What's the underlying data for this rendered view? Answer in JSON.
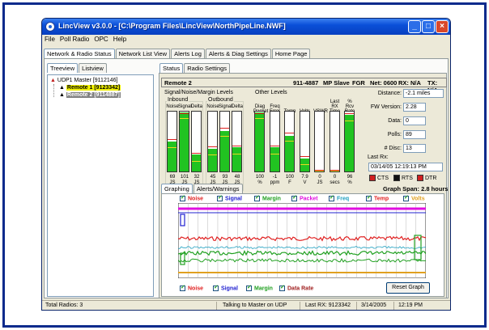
{
  "window": {
    "title": "LincView v3.0.0 - [C:\\Program Files\\LincView\\NorthPipeLine.NWF]"
  },
  "menu": [
    "File",
    "Poll Radio",
    "OPC",
    "Help"
  ],
  "main_tabs": [
    "Network & Radio Status",
    "Network List View",
    "Alerts Log",
    "Alerts & Diag Settings",
    "Home Page"
  ],
  "left_tabs": [
    "Treeview",
    "Listview"
  ],
  "right_tabs": [
    "Status",
    "Radio Settings"
  ],
  "tree": {
    "master": "UDP1 Master [9112146]",
    "remotes": [
      "Remote 1 [9123342]",
      "Remote 2 [9114887]"
    ]
  },
  "radio_header": {
    "name": "Remote 2",
    "id": "911-4887",
    "mode": "MP Slave",
    "fgr": "FGR",
    "net": "Net: 0600",
    "rx": "RX: N/A",
    "tx": "TX: N/A"
  },
  "signal_levels": {
    "title": "Signal/Noise/Margin Levels",
    "inbound": {
      "title": "Inbound",
      "labels": [
        "Noise",
        "Signal",
        "Delta"
      ],
      "values": [
        "69",
        "101",
        "32"
      ],
      "units": [
        "JS",
        "JS",
        "JS"
      ],
      "levels": [
        0.5,
        0.98,
        0.28
      ]
    },
    "outbound": {
      "title": "Outbound",
      "labels": [
        "Noise",
        "Signal",
        "Delta"
      ],
      "values": [
        "45",
        "93",
        "48"
      ],
      "units": [
        "JS",
        "JS",
        "JS"
      ],
      "levels": [
        0.38,
        0.68,
        0.4
      ]
    }
  },
  "other_levels": {
    "title": "Other Levels",
    "labels": [
      [
        "Diag",
        "Packet"
      ],
      [
        "Freq",
        "Error"
      ],
      [
        "",
        "Temp"
      ],
      [
        "",
        "Volts"
      ],
      [
        "",
        "VSWR"
      ],
      [
        "Last",
        "RX",
        "Time"
      ],
      [
        "%",
        "Rcv",
        "Rate"
      ]
    ],
    "values": [
      "100",
      "-1",
      "100",
      "7.9",
      "0",
      "0",
      "96"
    ],
    "units": [
      "%",
      "ppm",
      "F",
      "V",
      "JS",
      "secs",
      "%"
    ],
    "levels": [
      0.98,
      0.4,
      0.6,
      0.22,
      0.0,
      0.0,
      0.94
    ]
  },
  "info": {
    "distance_label": "Distance:",
    "distance": "-2.1 miles",
    "fw_label": "FW Version:",
    "fw": "2.28",
    "data_label": "Data:",
    "data": "0",
    "polls_label": "Polls:",
    "polls": "89",
    "disc_label": "# Disc:",
    "disc": "13",
    "lastrx_label": "Last Rx:",
    "lastrx": "03/14/05 12:19:13 PM"
  },
  "indicators": [
    "CTS",
    "RTS",
    "DTR"
  ],
  "graph_tabs": [
    "Graphing",
    "Alerts/Warnings"
  ],
  "graph_span": "Graph Span: 2.8 hours",
  "top_checks": [
    {
      "label": "Noise",
      "color": "#e02020"
    },
    {
      "label": "Signal",
      "color": "#2020d0"
    },
    {
      "label": "Margin",
      "color": "#20a020"
    },
    {
      "label": "Packet",
      "color": "#e010e0"
    },
    {
      "label": "Freq",
      "color": "#20a0c0"
    },
    {
      "label": "Temp",
      "color": "#e02020"
    },
    {
      "label": "Volts",
      "color": "#e0a020"
    }
  ],
  "bottom_checks": [
    {
      "label": "Noise",
      "color": "#e02020"
    },
    {
      "label": "Signal",
      "color": "#2020d0"
    },
    {
      "label": "Margin",
      "color": "#20a020"
    },
    {
      "label": "Data Rate",
      "color": "#a02020"
    }
  ],
  "reset_button": "Reset Graph",
  "statusbar": {
    "total": "Total Radios: 3",
    "talking": "Talking to Master on UDP",
    "last_rx": "Last RX: 9123342",
    "date": "3/14/2005",
    "time": "12:19 PM"
  },
  "colors": {
    "bar_fill": "#21c321",
    "marker_red": "#e02020",
    "marker_yellow": "#e8d820",
    "cts": "#d02020",
    "rts": "#101010",
    "dtr": "#d02020",
    "title_blue": "#0a4fd8"
  }
}
